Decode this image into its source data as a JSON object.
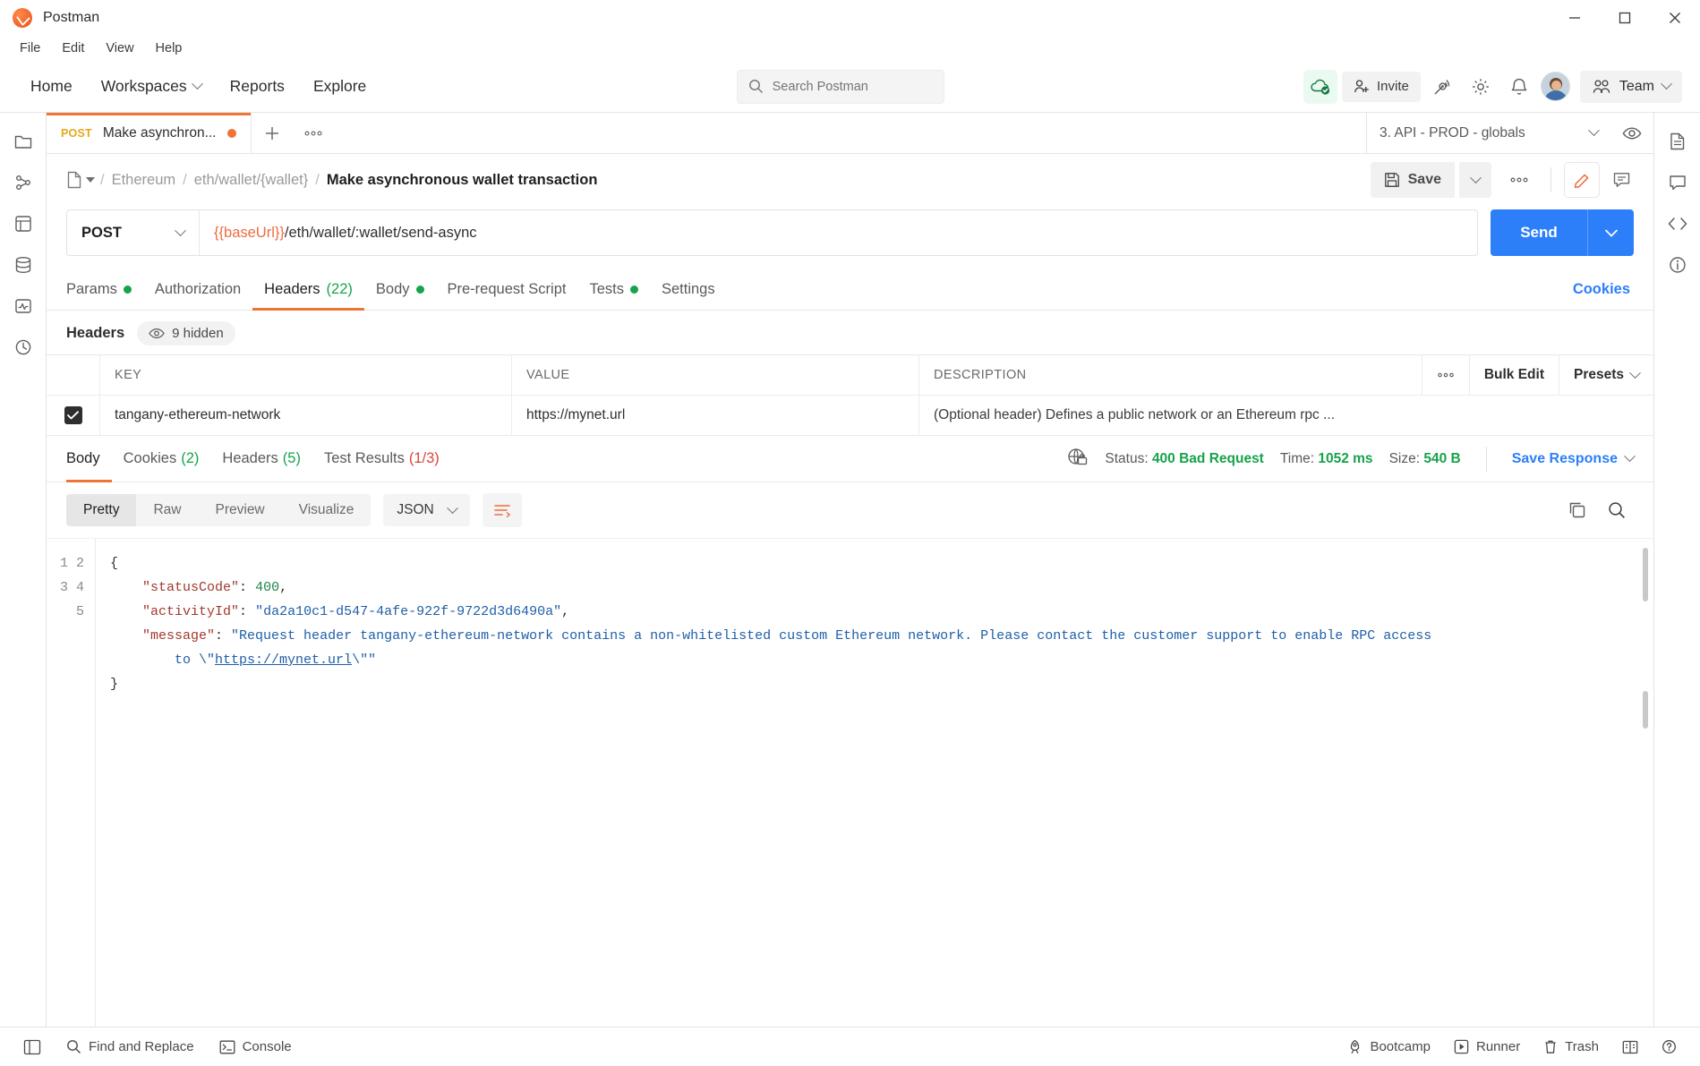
{
  "window": {
    "title": "Postman",
    "minimize_label": "Minimize",
    "maximize_label": "Maximize",
    "close_label": "Close"
  },
  "menubar": {
    "items": [
      {
        "label": "File"
      },
      {
        "label": "Edit"
      },
      {
        "label": "View"
      },
      {
        "label": "Help"
      }
    ]
  },
  "header": {
    "nav": [
      {
        "label": "Home"
      },
      {
        "label": "Workspaces"
      },
      {
        "label": "Reports"
      },
      {
        "label": "Explore"
      }
    ],
    "search": {
      "placeholder": "Search Postman",
      "value": ""
    },
    "invite_label": "Invite",
    "team_label": "Team"
  },
  "tabstrip": {
    "tabs": [
      {
        "method": "POST",
        "name": "Make asynchron...",
        "unsaved": true
      }
    ],
    "environment": "3. API - PROD - globals"
  },
  "breadcrumb": {
    "collection": "Ethereum",
    "folder": "eth/wallet/{wallet}",
    "current": "Make asynchronous wallet transaction",
    "separator": "/",
    "save_label": "Save"
  },
  "request": {
    "method": "POST",
    "url_variable": "{{baseUrl}}",
    "url_path": "/eth/wallet/:wallet/send-async",
    "send_label": "Send",
    "tabs": [
      {
        "label": "Params",
        "dot": true,
        "active": false
      },
      {
        "label": "Authorization",
        "dot": false,
        "active": false
      },
      {
        "label": "Headers",
        "count": "(22)",
        "active": true
      },
      {
        "label": "Body",
        "dot": true,
        "active": false
      },
      {
        "label": "Pre-request Script",
        "dot": false,
        "active": false
      },
      {
        "label": "Tests",
        "dot": true,
        "active": false
      },
      {
        "label": "Settings",
        "dot": false,
        "active": false
      }
    ],
    "cookies_link": "Cookies"
  },
  "headers_panel": {
    "title": "Headers",
    "hidden_label": "9 hidden",
    "columns": [
      "KEY",
      "VALUE",
      "DESCRIPTION"
    ],
    "actions": {
      "bulk_edit": "Bulk Edit",
      "presets": "Presets"
    },
    "rows": [
      {
        "checked": true,
        "key": "tangany-ethereum-network",
        "value": "https://mynet.url",
        "description": "(Optional header) Defines a public network or an Ethereum rpc ..."
      }
    ]
  },
  "response": {
    "tabs": [
      {
        "label": "Body",
        "count": "",
        "active": true
      },
      {
        "label": "Cookies",
        "count": "(2)",
        "count_color": "green",
        "active": false
      },
      {
        "label": "Headers",
        "count": "(5)",
        "count_color": "green",
        "active": false
      },
      {
        "label": "Test Results",
        "count": "(1/3)",
        "count_color": "red",
        "active": false
      }
    ],
    "status_label": "Status:",
    "status_value": "400 Bad Request",
    "time_label": "Time:",
    "time_value": "1052 ms",
    "size_label": "Size:",
    "size_value": "540 B",
    "save_response": "Save Response",
    "viewer_modes": [
      {
        "label": "Pretty",
        "active": true
      },
      {
        "label": "Raw",
        "active": false
      },
      {
        "label": "Preview",
        "active": false
      },
      {
        "label": "Visualize",
        "active": false
      }
    ],
    "format": "JSON",
    "line_numbers": [
      "1",
      "2",
      "3",
      "4",
      "5"
    ],
    "body": {
      "open_brace": "{",
      "close_brace": "}",
      "fields": [
        {
          "key": "\"statusCode\"",
          "sep": ": ",
          "value": "400",
          "type": "num",
          "comma": ","
        },
        {
          "key": "\"activityId\"",
          "sep": ": ",
          "value": "\"da2a10c1-d547-4afe-922f-9722d3d6490a\"",
          "type": "str",
          "comma": ","
        },
        {
          "key": "\"message\"",
          "sep": ": ",
          "value": "\"Request header tangany-ethereum-network contains a non-whitelisted custom Ethereum network. Please contact the customer support to enable RPC access to \\\"https://mynet.url\\\"\"",
          "type": "str",
          "comma": ""
        }
      ],
      "message_part1": "\"Request header tangany-ethereum-network contains a non-whitelisted custom Ethereum network. Please contact the customer support to enable RPC access",
      "message_part2_pre": "to \\\"",
      "message_link": "https://mynet.url",
      "message_part2_post": "\\\"\""
    }
  },
  "bottombar": {
    "left": [
      {
        "label": "Find and Replace",
        "icon": "search-icon"
      },
      {
        "label": "Console",
        "icon": "terminal-icon"
      }
    ],
    "right": [
      {
        "label": "Bootcamp",
        "icon": "rocket-icon"
      },
      {
        "label": "Runner",
        "icon": "play-icon"
      },
      {
        "label": "Trash",
        "icon": "trash-icon"
      }
    ]
  },
  "colors": {
    "accent_orange": "#ef7534",
    "send_blue": "#2d7ff9",
    "success_green": "#16a34a",
    "error_red": "#d9463c",
    "method_post": "#e6a817"
  }
}
